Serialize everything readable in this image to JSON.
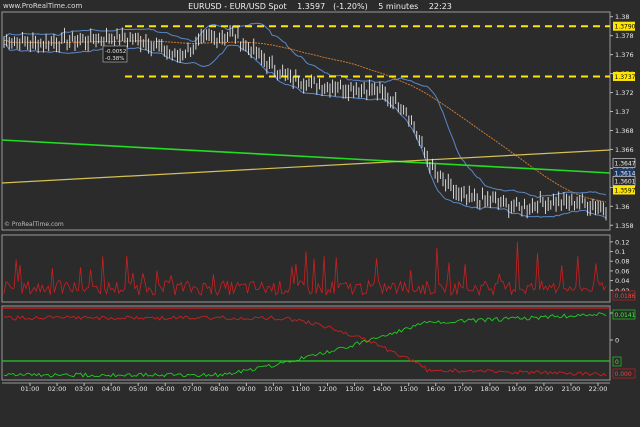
{
  "header": {
    "source_url": "www.ProRealTime.com",
    "instrument": "EURUSD - EUR/USD Spot",
    "price": "1.3597",
    "change": "(-1.20%)",
    "timeframe": "5 minutes",
    "time": "22:23"
  },
  "watermark": "© ProRealTime.com",
  "price_panel": {
    "y_ticks": [
      "1.38",
      "1.378",
      "1.376",
      "1.374",
      "1.372",
      "1.37",
      "1.368",
      "1.366",
      "1.364",
      "1.362",
      "1.36",
      "1.358"
    ],
    "level_labels": [
      "1.3790",
      "1.3737",
      "1.3647",
      "1.3614",
      "1.3601",
      "1.3597"
    ],
    "level_colors": [
      "#ffe600",
      "#ffe600",
      "#2b2b2b",
      "#1e3a6a",
      "#2b2b2b",
      "#ffe600"
    ],
    "callout": [
      "-0.0052",
      "-0.38%"
    ]
  },
  "middle_panel": {
    "y_ticks": [
      "0.12",
      "0.1",
      "0.08",
      "0.06",
      "0.04",
      "0.02"
    ],
    "last_value": "0.0186"
  },
  "bottom_panel": {
    "y_ticks": [
      "0.005",
      "0"
    ],
    "last_green": "0.0141",
    "last_red": "0.000",
    "marker": "0"
  },
  "x_axis": {
    "ticks": [
      "01:00",
      "02:00",
      "03:00",
      "04:00",
      "05:00",
      "06:00",
      "07:00",
      "08:00",
      "09:00",
      "10:00",
      "11:00",
      "12:00",
      "13:00",
      "14:00",
      "15:00",
      "16:00",
      "17:00",
      "18:00",
      "19:00",
      "20:00",
      "21:00",
      "22:00"
    ]
  },
  "colors": {
    "background": "#2b2b2b",
    "price_bars": "#e8e8e8",
    "bollinger": "#5a88c8",
    "moving_avg": "#c87832",
    "resistance": "#ffe600",
    "trend_green": "#22dd22",
    "trend_yellow": "#d6c054",
    "oscillator_red": "#cc2020",
    "oscillator_green": "#22cc22"
  },
  "chart_data": {
    "type": "line",
    "price_min": 1.3575,
    "price_max": 1.3805,
    "x": [
      "01:00",
      "02:00",
      "03:00",
      "04:00",
      "05:00",
      "06:00",
      "07:00",
      "08:00",
      "09:00",
      "10:00",
      "11:00",
      "12:00",
      "13:00",
      "14:00",
      "15:00",
      "16:00",
      "17:00",
      "18:00",
      "19:00",
      "20:00",
      "21:00",
      "22:00"
    ],
    "close": [
      1.3775,
      1.3772,
      1.3774,
      1.3776,
      1.3778,
      1.3774,
      1.3758,
      1.3776,
      1.3782,
      1.3755,
      1.3735,
      1.3728,
      1.3725,
      1.3722,
      1.3704,
      1.3635,
      1.3608,
      1.3606,
      1.3598,
      1.3605,
      1.3605,
      1.3597
    ],
    "resistance_levels": [
      1.379,
      1.3737
    ]
  }
}
